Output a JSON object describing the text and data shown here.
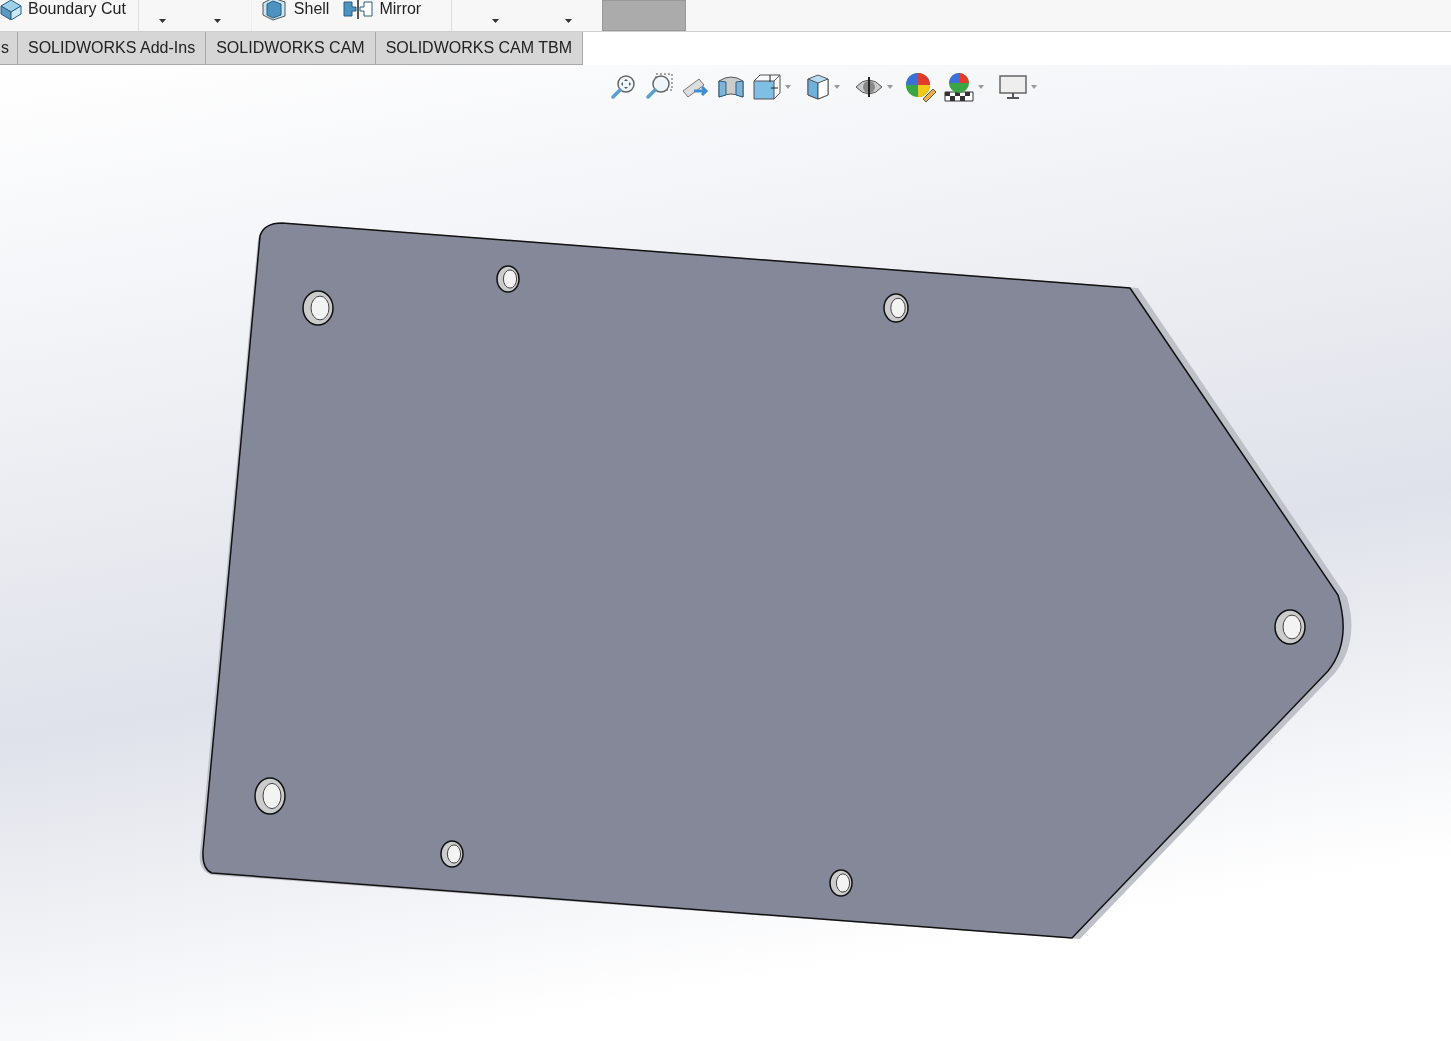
{
  "ribbon": {
    "commands": [
      {
        "label": "Boundary Cut"
      },
      {
        "label": "Shell"
      },
      {
        "label": "Mirror"
      }
    ]
  },
  "tabs": [
    {
      "label": "s",
      "selected": false
    },
    {
      "label": "SOLIDWORKS Add-Ins",
      "selected": false
    },
    {
      "label": "SOLIDWORKS CAM",
      "selected": false
    },
    {
      "label": "SOLIDWORKS CAM TBM",
      "selected": false
    }
  ]
}
